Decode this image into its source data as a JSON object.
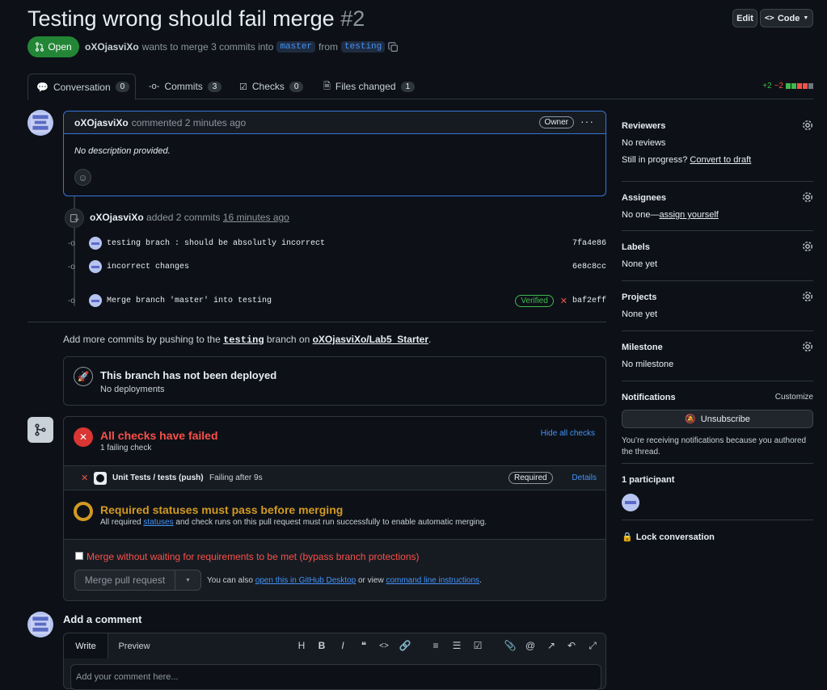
{
  "header": {
    "title": "Testing wrong should fail merge",
    "number": "#2",
    "edit_label": "Edit",
    "code_label": "Code",
    "status": "Open",
    "author": "oXOjasviXo",
    "merge_text_1": "wants to merge 3 commits into",
    "base_branch": "master",
    "merge_text_2": "from",
    "head_branch": "testing"
  },
  "tabs": [
    {
      "label": "Conversation",
      "count": "0",
      "icon": "comment-discussion-icon"
    },
    {
      "label": "Commits",
      "count": "3",
      "icon": "git-commit-icon"
    },
    {
      "label": "Checks",
      "count": "0",
      "icon": "checklist-icon"
    },
    {
      "label": "Files changed",
      "count": "1",
      "icon": "file-diff-icon"
    }
  ],
  "diffstat": {
    "additions": "+2",
    "deletions": "−2"
  },
  "comment": {
    "author": "oXOjasviXo",
    "meta": "commented 2 minutes ago",
    "badge": "Owner",
    "body": "No description provided."
  },
  "commit_event": {
    "author": "oXOjasviXo",
    "text": "added 2 commits",
    "time": "16 minutes ago"
  },
  "commits": [
    {
      "message": "testing brach : should be absolutly incorrect",
      "sha": "7fa4e86"
    },
    {
      "message": "incorrect changes",
      "sha": "6e8c8cc"
    },
    {
      "message": "Merge branch 'master' into testing",
      "sha": "baf2eff",
      "verified": "Verified"
    }
  ],
  "push_hint": {
    "prefix": "Add more commits by pushing to the",
    "branch": "testing",
    "middle": "branch on",
    "repo": "oXOjasviXo/Lab5_Starter",
    "suffix": "."
  },
  "deploy": {
    "title": "This branch has not been deployed",
    "subtitle": "No deployments"
  },
  "checks": {
    "title": "All checks have failed",
    "subtitle": "1 failing check",
    "hide_label": "Hide all checks",
    "check_name": "Unit Tests / tests (push)",
    "check_status": "Failing after 9s",
    "required_badge": "Required",
    "details_label": "Details",
    "req_title": "Required statuses must pass before merging",
    "req_text_1": "All required",
    "req_link": "statuses",
    "req_text_2": "and check runs on this pull request must run successfully to enable automatic merging.",
    "bypass_label": "Merge without waiting for requirements to be met (bypass branch protections)",
    "merge_button": "Merge pull request",
    "also_text": "You can also",
    "desktop_link": "open this in GitHub Desktop",
    "or_view": "or view",
    "cli_link": "command line instructions",
    "period": "."
  },
  "add_comment": {
    "title": "Add a comment",
    "write_tab": "Write",
    "preview_tab": "Preview",
    "placeholder": "Add your comment here..."
  },
  "sidebar": {
    "reviewers": {
      "title": "Reviewers",
      "value": "No reviews",
      "draft_text": "Still in progress?",
      "draft_link": "Convert to draft"
    },
    "assignees": {
      "title": "Assignees",
      "value": "No one—",
      "assign_link": "assign yourself"
    },
    "labels": {
      "title": "Labels",
      "value": "None yet"
    },
    "projects": {
      "title": "Projects",
      "value": "None yet"
    },
    "milestone": {
      "title": "Milestone",
      "value": "No milestone"
    },
    "notifications": {
      "title": "Notifications",
      "customize": "Customize",
      "unsubscribe": "Unsubscribe",
      "reason": "You’re receiving notifications because you authored the thread."
    },
    "participants": {
      "title": "1 participant"
    },
    "lock": "Lock conversation"
  },
  "colors": {
    "accent": "#4493f8",
    "success": "#238636",
    "danger": "#f85149",
    "attention": "#d29922"
  }
}
